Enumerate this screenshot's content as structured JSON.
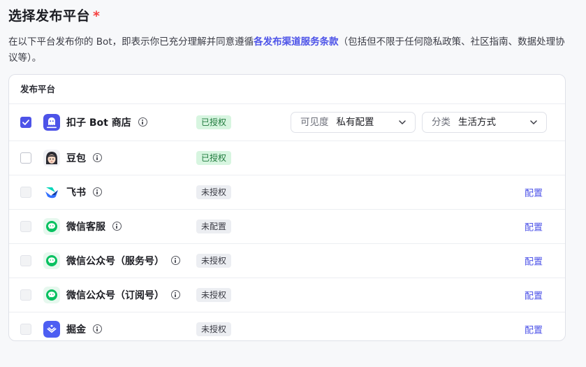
{
  "section": {
    "title": "选择发布平台",
    "required_mark": "*",
    "description_prefix": "在以下平台发布你的 Bot，即表示你已充分理解并同意遵循",
    "description_link": "各发布渠道服务条款",
    "description_suffix": "（包括但不限于任何隐私政策、社区指南、数据处理协议等）。"
  },
  "table": {
    "header": "发布平台",
    "rows": [
      {
        "name": "扣子 Bot 商店",
        "status": "已授权",
        "checked": true,
        "icon": "coze-bot-store-icon"
      },
      {
        "name": "豆包",
        "status": "已授权",
        "checked": false,
        "icon": "doubao-icon"
      },
      {
        "name": "飞书",
        "status": "未授权",
        "action": "配置",
        "icon": "feishu-icon"
      },
      {
        "name": "微信客服",
        "status": "未配置",
        "action": "配置",
        "icon": "wechat-icon"
      },
      {
        "name": "微信公众号（服务号）",
        "status": "未授权",
        "action": "配置",
        "icon": "wechat-icon"
      },
      {
        "name": "微信公众号（订阅号）",
        "status": "未授权",
        "action": "配置",
        "icon": "wechat-icon"
      },
      {
        "name": "掘金",
        "status": "未授权",
        "action": "配置",
        "icon": "juejin-icon"
      }
    ]
  },
  "visibility_select": {
    "label": "可见度",
    "value": "私有配置"
  },
  "category_select": {
    "label": "分类",
    "value": "生活方式"
  },
  "colors": {
    "accent": "#4d53e8",
    "required": "#f53f3f",
    "authorized_bg": "#d7f5e0",
    "wechat_green": "#07c160"
  }
}
